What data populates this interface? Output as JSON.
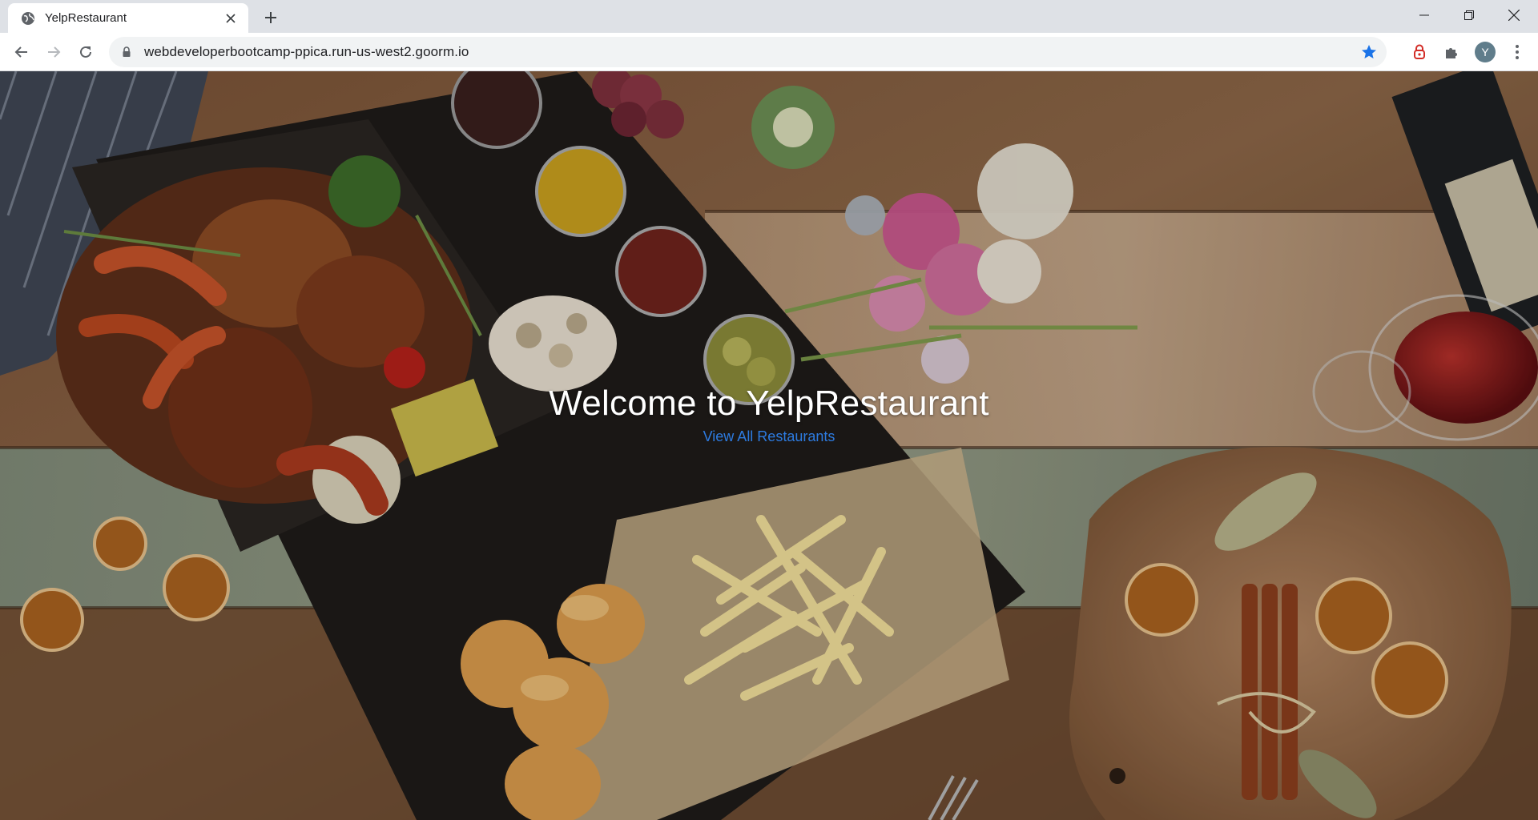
{
  "browser": {
    "tab": {
      "title": "YelpRestaurant",
      "favicon": "globe-icon"
    },
    "new_tab_icon": "plus-icon",
    "window_controls": [
      "minimize-icon",
      "restore-icon",
      "close-icon"
    ],
    "omnibox": {
      "url": "webdeveloperbootcamp-ppica.run-us-west2.goorm.io",
      "bookmarked": true
    },
    "profile_initial": "Y",
    "accent_color": "#1a73e8"
  },
  "page": {
    "title": "Welcome to YelpRestaurant",
    "link_label": "View All Restaurants",
    "link_color": "#2d7be0",
    "background": "food-table-photo"
  }
}
